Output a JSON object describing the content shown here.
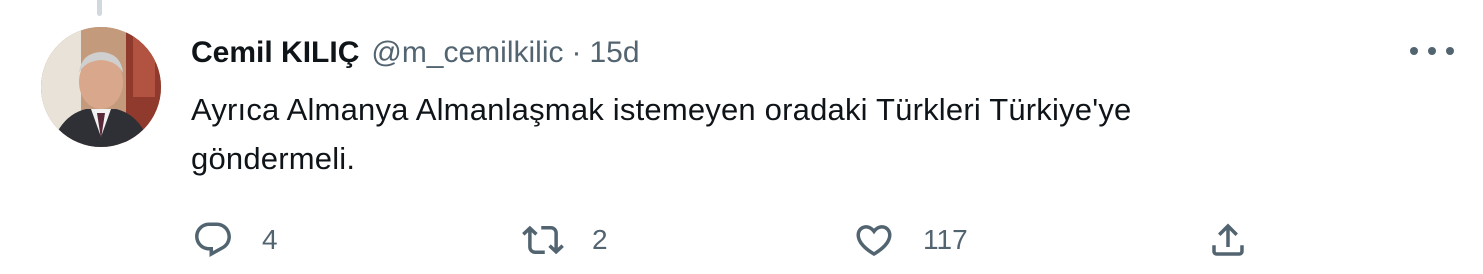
{
  "tweet": {
    "author_name": "Cemil KILIÇ",
    "author_handle": "@m_cemilkilic",
    "separator": "·",
    "time": "15d",
    "text_line1": "Ayrıca Almanya Almanlaşmak istemeyen oradaki Türkleri Türkiye'ye",
    "text_line2": "göndermeli."
  },
  "actions": {
    "reply_count": "4",
    "retweet_count": "2",
    "like_count": "117"
  },
  "icons": {
    "more": "more-horizontal-icon",
    "reply": "reply-icon",
    "retweet": "retweet-icon",
    "like": "heart-icon",
    "share": "share-icon"
  },
  "colors": {
    "text_primary": "#0f1419",
    "text_secondary": "#536471"
  }
}
